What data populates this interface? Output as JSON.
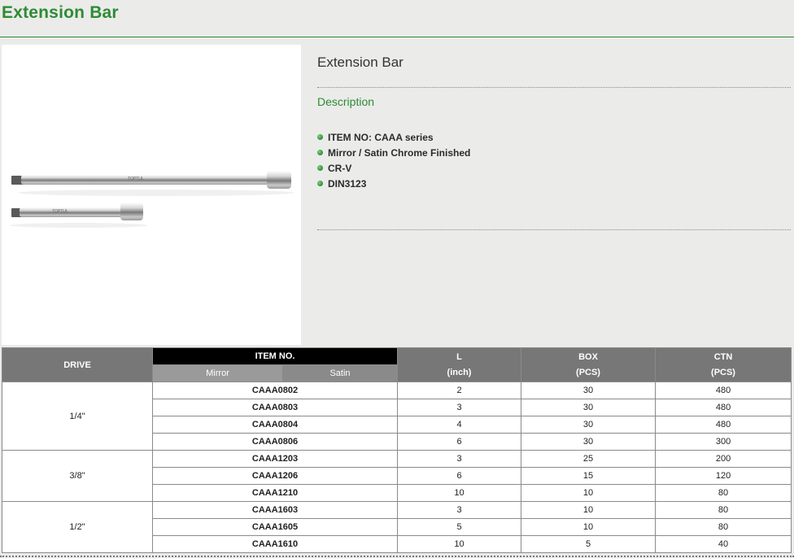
{
  "page": {
    "title": "Extension Bar"
  },
  "product": {
    "name": "Extension Bar",
    "description_heading": "Description",
    "features": [
      "ITEM NO: CAAA series",
      "Mirror / Satin Chrome Finished",
      "CR-V",
      "DIN3123"
    ],
    "image_labels": {
      "long_bar": "TOPTUL",
      "short_bar": "TOPTUL"
    }
  },
  "table": {
    "headers": {
      "drive": "DRIVE",
      "item_no": "ITEM NO.",
      "mirror": "Mirror",
      "satin": "Satin",
      "l": "L",
      "l_unit": "(inch)",
      "box": "BOX",
      "box_unit": "(PCS)",
      "ctn": "CTN",
      "ctn_unit": "(PCS)"
    },
    "groups": [
      {
        "drive": "1/4\"",
        "rows": [
          {
            "item": "CAAA0802",
            "l": "2",
            "box": "30",
            "ctn": "480"
          },
          {
            "item": "CAAA0803",
            "l": "3",
            "box": "30",
            "ctn": "480"
          },
          {
            "item": "CAAA0804",
            "l": "4",
            "box": "30",
            "ctn": "480"
          },
          {
            "item": "CAAA0806",
            "l": "6",
            "box": "30",
            "ctn": "300"
          }
        ]
      },
      {
        "drive": "3/8\"",
        "rows": [
          {
            "item": "CAAA1203",
            "l": "3",
            "box": "25",
            "ctn": "200"
          },
          {
            "item": "CAAA1206",
            "l": "6",
            "box": "15",
            "ctn": "120"
          },
          {
            "item": "CAAA1210",
            "l": "10",
            "box": "10",
            "ctn": "80"
          }
        ]
      },
      {
        "drive": "1/2\"",
        "rows": [
          {
            "item": "CAAA1603",
            "l": "3",
            "box": "10",
            "ctn": "80"
          },
          {
            "item": "CAAA1605",
            "l": "5",
            "box": "10",
            "ctn": "80"
          },
          {
            "item": "CAAA1610",
            "l": "10",
            "box": "5",
            "ctn": "40"
          }
        ]
      }
    ]
  },
  "colors": {
    "accent": "#2e8b34",
    "header_bg": "#777777",
    "page_bg": "#ebebea"
  }
}
